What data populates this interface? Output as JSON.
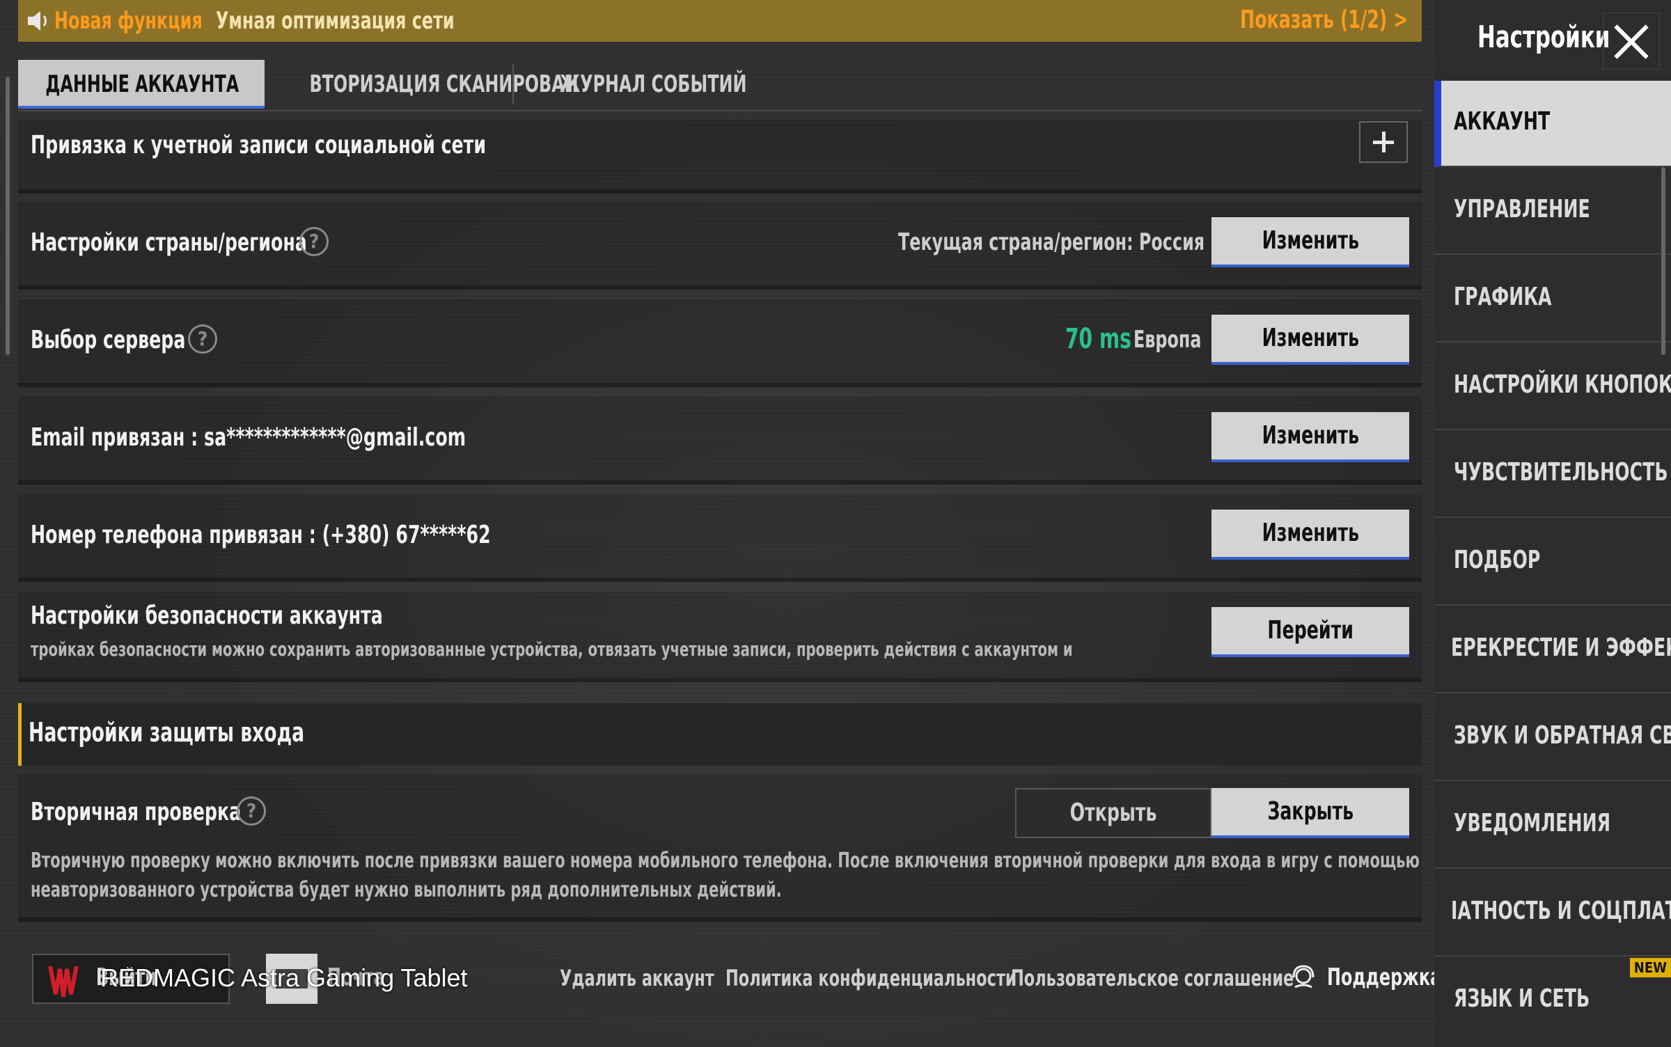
{
  "banner": {
    "new_feature": "Новая функция",
    "message": "Умная оптимизация сети",
    "show_label": "Показать (1/2) >"
  },
  "tabs": [
    {
      "label": "ДАННЫЕ АККАУНТА",
      "active": true
    },
    {
      "label": "ВТОРИЗАЦИЯ СКАНИРОВАН",
      "active": false
    },
    {
      "label": "ЖУРНАЛ СОБЫТИЙ",
      "active": false
    }
  ],
  "rows": {
    "social": {
      "label": "Привязка к учетной записи социальной сети"
    },
    "region": {
      "label": "Настройки страны/региона",
      "current": "Текущая страна/регион: Россия",
      "button": "Изменить"
    },
    "server": {
      "label": "Выбор сервера",
      "ping": "70 ms",
      "region": "Европа",
      "button": "Изменить"
    },
    "email": {
      "label": "Email привязан : sa*************@gmail.com",
      "button": "Изменить"
    },
    "phone": {
      "label": "Номер телефона привязан : (+380) 67*****62",
      "button": "Изменить"
    },
    "security": {
      "label": "Настройки безопасности аккаунта",
      "desc": "тройках безопасности можно сохранить авторизованные устройства, отвязать учетные записи, проверить действия с аккаунтом и",
      "button": "Перейти"
    }
  },
  "login_protection": {
    "title": "Настройки защиты входа",
    "secondary": {
      "label": "Вторичная проверка",
      "open": "Открыть",
      "close": "Закрыть",
      "desc_line1": "Вторичную проверку можно включить после привязки вашего номера мобильного телефона. После включения вторичной проверки для входа в игру с помощью",
      "desc_line2": "неавторизованного устройства будет нужно выполнить ряд дополнительных действий."
    }
  },
  "footer": {
    "logo_tag": "Выйти",
    "watermark": "REDMAGIC Astra Gaming Tablet",
    "msg_label": "Почта",
    "links": [
      "Удалить аккаунт",
      "Политика конфиденциальности",
      "Пользовательское соглашение"
    ],
    "support": "Поддержка"
  },
  "side": {
    "title": "Настройки",
    "items": [
      {
        "label": "АККАУНТ",
        "active": true
      },
      {
        "label": "УПРАВЛЕНИЕ"
      },
      {
        "label": "ГРАФИКА"
      },
      {
        "label": "НАСТРОЙКИ КНОПОК"
      },
      {
        "label": "ЧУВСТВИТЕЛЬНОСТЬ"
      },
      {
        "label": "ПОДБОР"
      },
      {
        "label": "ЕРЕКРЕСТИЕ И ЭФФЕКТЫ"
      },
      {
        "label": "ЗВУК И ОБРАТНАЯ СВЯЗЬ"
      },
      {
        "label": "УВЕДОМЛЕНИЯ"
      },
      {
        "label": "ІАТНОСТЬ И СОЦПЛАТФОР"
      },
      {
        "label": "ЯЗЫК И СЕТЬ",
        "badge": "NEW"
      }
    ]
  },
  "colors": {
    "accent": "#e8b020",
    "banner": "#8c7229",
    "ping": "#2bbf8f",
    "active_nav": "#2a3fd0"
  }
}
